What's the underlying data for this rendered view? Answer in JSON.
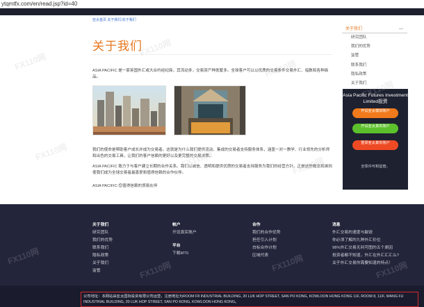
{
  "url": "ytqmtfx.com/en/read.jsp?id=40",
  "breadcrumb": "亚太首页 关于我们/关于我们",
  "title": "关于我们",
  "paragraphs": [
    "ASIA PACIFIC 是一家英国外汇或大合约经纪商，其流动多，交易资产种类繁多。全球客户可以以优质的交易条件交易外汇、指数和各种商品。",
    "我们的使命是帮助客户成长并成为交易者。这就是为什么我们提供流动、集成的交易者支持服务体系，涵盖一对一教学、行业领先的分析师和出色的交易工具，让我们的客户信赖的更好以及更完整的交易决策。",
    "ASIA PACIFIC 致力于与客户建立长期的合作关系。我们以诚信、透明和提供优质的交易者支持服务为我们的经营方针。正是这些概念和准则使我们成为全球交易者最喜爱和值得信赖的合作伙伴。",
    "ASIA PACIFIC-您值得信赖的贸易伙伴"
  ],
  "sidebar": {
    "heading": "关于我们",
    "collapse": "—",
    "items": [
      "研究团队",
      "我们的优势",
      "监管",
      "联系我们",
      "隐私政策",
      "关于我们"
    ]
  },
  "promo": {
    "title": "Asia Pacific Futures Investment Limited投资",
    "buttons": [
      "开设亚太模拟账户",
      "开设亚太真实账户",
      "登录亚太真实账户"
    ],
    "note": "全球许可和监管。"
  },
  "footer": {
    "columns": [
      {
        "heading": "关于我们",
        "items": [
          "研究团队",
          "我们的优势",
          "联系我们",
          "隐私政策",
          "关于我们",
          "监管"
        ]
      },
      {
        "heading": "帐户",
        "items": [
          "开设真实账户"
        ],
        "heading2": "平台",
        "items2": [
          "下载MT5"
        ]
      },
      {
        "heading": "合作",
        "items": [
          "我们的合作优势",
          "担任引入计划",
          "白标合作计划",
          "区域代表"
        ]
      },
      {
        "heading": "消息",
        "items": [
          "外汇交易的速度与敏锐",
          "你必须了解的九种外汇价位",
          "98%外汇交易无利可图的五个原因",
          "投资者都不知道，外汇在外汇汇汇么?",
          "关于外汇交易你需要知道的特点！"
        ]
      }
    ]
  },
  "address": "公司地址：本网站由亚太国际投资有限公司运营，注册地址为ROOM F8 INDUSTRIAL BUILDING, 20 LUK HOP STREET, SAN PO KONG, KOWLOON HONG KONG 11F, ROOM 8, 11/F, WANG FU INDUSTRIAL BUILDING, 20 LUK HOP STREET, SAN PO KONG, KOWLOON HONG KONG。",
  "watermark": "FX110网",
  "colors": {
    "accent": "#e5771f",
    "dark": "#23253a",
    "green": "#5cc02c",
    "red": "#ee4a24"
  }
}
